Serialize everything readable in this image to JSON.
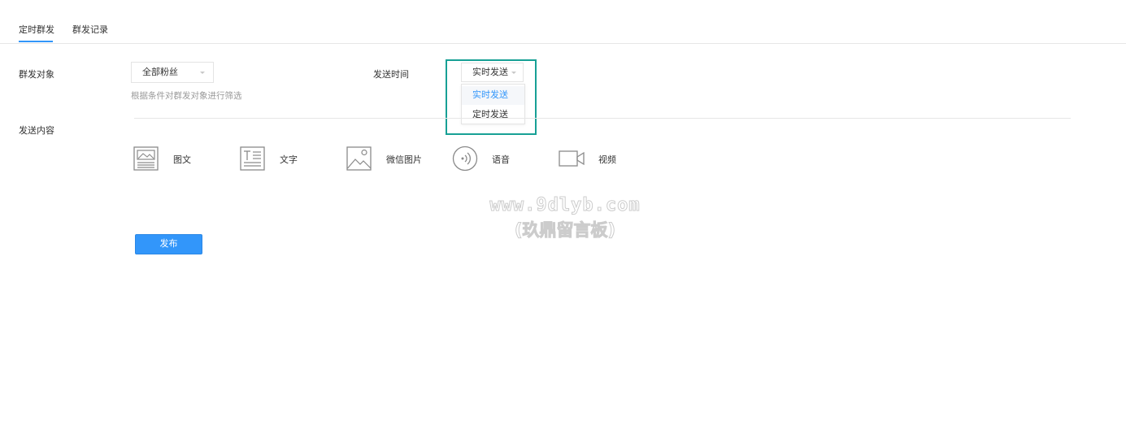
{
  "tabs": [
    {
      "label": "定时群发",
      "active": true
    },
    {
      "label": "群发记录",
      "active": false
    }
  ],
  "form": {
    "target_label": "群发对象",
    "target_select_value": "全部粉丝",
    "target_hint": "根据条件对群发对象进行筛选",
    "send_time_label": "发送时间",
    "send_time_value": "实时发送",
    "send_time_options": [
      "实时发送",
      "定时发送"
    ],
    "content_label": "发送内容"
  },
  "media_types": [
    {
      "label": "图文",
      "icon": "image-text-icon"
    },
    {
      "label": "文字",
      "icon": "text-icon"
    },
    {
      "label": "微信图片",
      "icon": "image-icon"
    },
    {
      "label": "语音",
      "icon": "voice-icon"
    },
    {
      "label": "视频",
      "icon": "video-icon"
    }
  ],
  "publish_label": "发布",
  "watermark": {
    "line1": "www.9dlyb.com",
    "line2": "(玖鼎留言板)"
  },
  "colors": {
    "accent": "#3296fa",
    "highlight": "#17a095",
    "icon": "#8a8a8a"
  }
}
